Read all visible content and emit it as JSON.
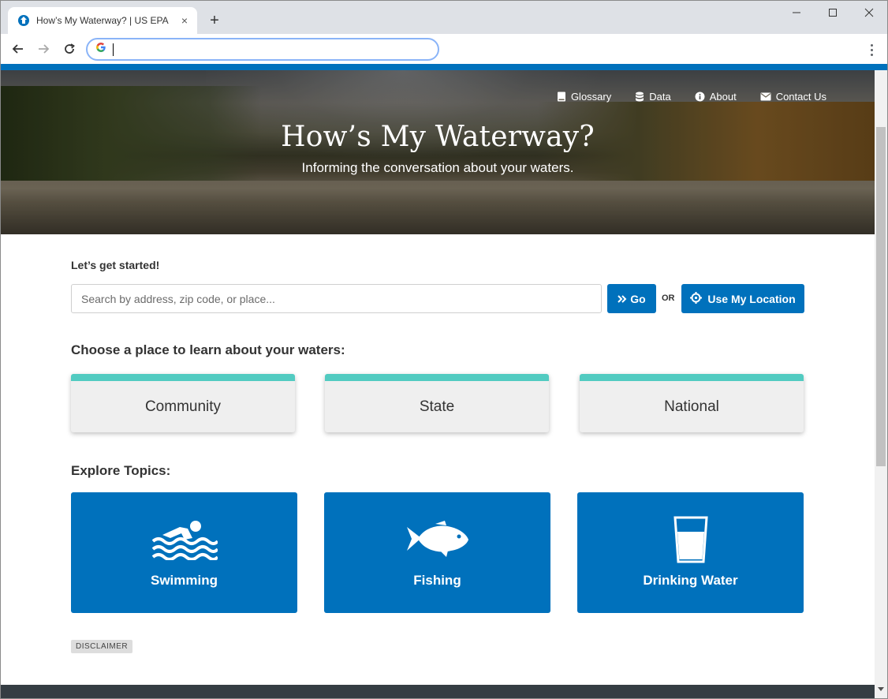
{
  "browser": {
    "tab_title": "How’s My Waterway? | US EPA",
    "tab_close": "×",
    "new_tab": "+",
    "address_value": ""
  },
  "hero": {
    "nav": [
      {
        "label": "Glossary",
        "icon": "book-icon"
      },
      {
        "label": "Data",
        "icon": "database-icon"
      },
      {
        "label": "About",
        "icon": "info-icon"
      },
      {
        "label": "Contact Us",
        "icon": "envelope-icon"
      }
    ],
    "title": "How’s My Waterway?",
    "subtitle": "Informing the conversation about your waters."
  },
  "search": {
    "label": "Let’s get started!",
    "placeholder": "Search by address, zip code, or place...",
    "go_label": "Go",
    "or_label": "OR",
    "location_label": "Use My Location"
  },
  "places": {
    "heading": "Choose a place to learn about your waters:",
    "items": [
      "Community",
      "State",
      "National"
    ]
  },
  "topics": {
    "heading": "Explore Topics:",
    "items": [
      {
        "label": "Swimming",
        "icon": "swimmer-icon"
      },
      {
        "label": "Fishing",
        "icon": "fish-icon"
      },
      {
        "label": "Drinking Water",
        "icon": "water-glass-icon"
      }
    ]
  },
  "disclaimer": "DISCLAIMER",
  "colors": {
    "primary": "#0071bc",
    "accent": "#52cbc1",
    "card": "#efefef",
    "footer": "#353d43"
  }
}
